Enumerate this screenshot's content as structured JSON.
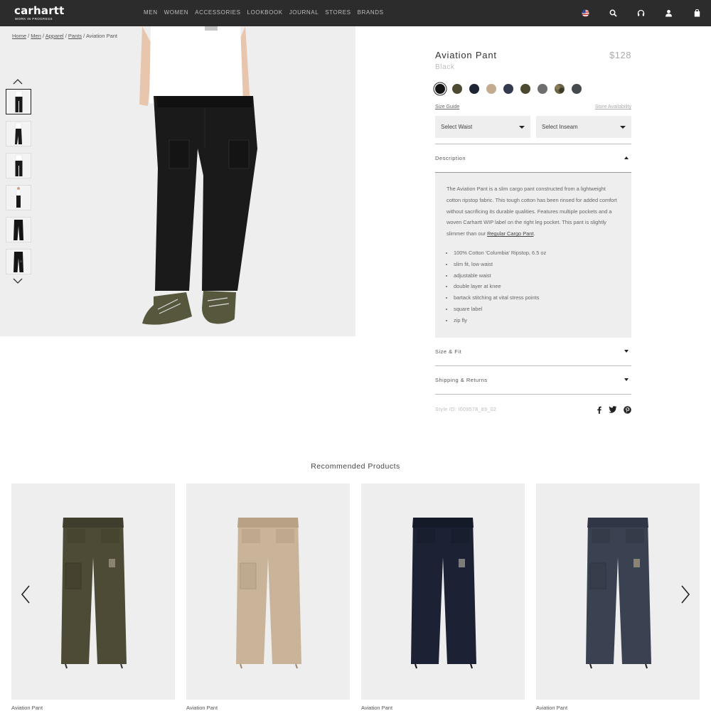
{
  "header": {
    "logo_brand": "carhartt",
    "logo_tagline": "WORK IN PROGRESS",
    "nav": [
      "MEN",
      "WOMEN",
      "ACCESSORIES",
      "LOOKBOOK",
      "JOURNAL",
      "STORES",
      "BRANDS"
    ],
    "icons": [
      "us-flag-icon",
      "search-icon",
      "headphones-icon",
      "account-icon",
      "bag-icon"
    ]
  },
  "breadcrumb": {
    "items": [
      "Home",
      "Men",
      "Apparel",
      "Pants"
    ],
    "current": "Aviation Pant",
    "separator": "/"
  },
  "gallery": {
    "thumbnail_count": 6,
    "active_thumbnail": 1
  },
  "product": {
    "title": "Aviation Pant",
    "price": "$128",
    "color": "Black",
    "swatches": [
      "#141414",
      "#4d4a33",
      "#1e2433",
      "#c4aa8e",
      "#333a4e",
      "#4b4a30",
      "#6e6e6e",
      "camo",
      "#444a4d"
    ],
    "selected_swatch": 0,
    "size_guide": "Size Guide",
    "store_availability": "Store Availability",
    "select_waist": "Select Waist",
    "select_inseam": "Select Inseam",
    "description_label": "Description",
    "description_text": "The Aviation Pant is a slim cargo pant constructed from a lightweight cotton ripstop fabric. This tough cotton has been rinsed for added comfort without sacrificing its durable qualities. Features multiple pockets and a woven Carhartt WIP label on the right leg pocket. This pant is slightly slimmer than our ",
    "description_link": "Regular Cargo Pant",
    "description_end": ".",
    "features": [
      "100% Cotton 'Columbia' Ripstop, 6.5 oz",
      "slim fit, low waist",
      "adjustable waist",
      "double layer at knee",
      "bartack stitching at vital stress points",
      "square label",
      "zip fly"
    ],
    "size_fit_label": "Size & Fit",
    "shipping_label": "Shipping & Returns",
    "style_id": "Style ID: I009578_89_02",
    "social": [
      "facebook-icon",
      "twitter-icon",
      "pinterest-icon"
    ]
  },
  "recommended": {
    "title": "Recommended Products",
    "items": [
      {
        "name": "Aviation Pant",
        "color": "#4d4a35"
      },
      {
        "name": "Aviation Pant",
        "color": "#c9b49a"
      },
      {
        "name": "Aviation Pant",
        "color": "#1c2234"
      },
      {
        "name": "Aviation Pant",
        "color": "#3a4150"
      }
    ]
  }
}
